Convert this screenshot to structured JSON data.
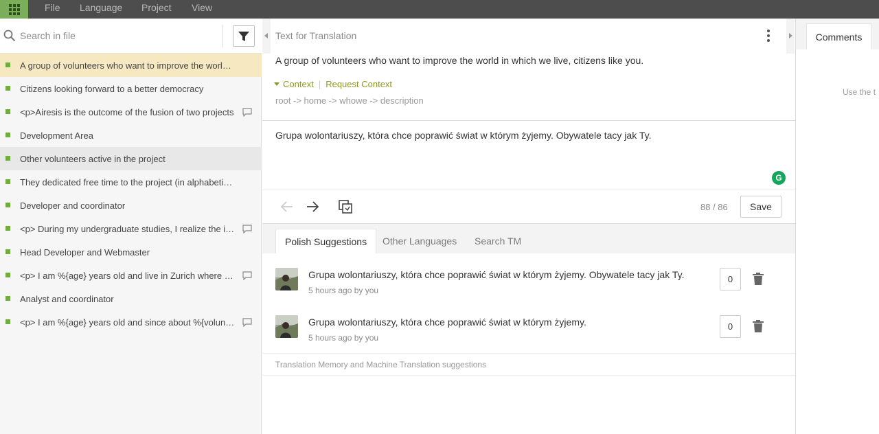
{
  "menubar": {
    "apps_icon": "grid-icon",
    "items": [
      {
        "label": "File"
      },
      {
        "label": "Language"
      },
      {
        "label": "Project"
      },
      {
        "label": "View"
      }
    ]
  },
  "search": {
    "placeholder": "Search in file",
    "icon": "search-icon",
    "filter_icon": "filter-icon"
  },
  "units": [
    {
      "text": "A group of volunteers who want to improve the world in which we live, citizens like you.",
      "state": "active",
      "has_comment": false
    },
    {
      "text": "Citizens looking forward to a better democracy",
      "state": "normal",
      "has_comment": false
    },
    {
      "text": "<p>Airesis is the outcome of the fusion of two projects",
      "state": "normal",
      "has_comment": true
    },
    {
      "text": "Development Area",
      "state": "normal",
      "has_comment": false
    },
    {
      "text": "Other volunteers active in the project",
      "state": "hover",
      "has_comment": false
    },
    {
      "text": "They dedicated free time to the project (in alphabetical order)",
      "state": "normal",
      "has_comment": false
    },
    {
      "text": "Developer and coordinator",
      "state": "normal",
      "has_comment": false
    },
    {
      "text": "<p> During my undergraduate studies, I realize the importance",
      "state": "normal",
      "has_comment": true
    },
    {
      "text": "Head Developer and Webmaster",
      "state": "normal",
      "has_comment": false
    },
    {
      "text": "<p> I am %{age} years old and live in Zurich where I work",
      "state": "normal",
      "has_comment": true
    },
    {
      "text": "Analyst and coordinator",
      "state": "normal",
      "has_comment": false
    },
    {
      "text": "<p> I am %{age} years old and since about %{volunteer} years",
      "state": "normal",
      "has_comment": true
    }
  ],
  "editor": {
    "source_label": "Text for Translation",
    "source_text": "A group of volunteers who want to improve the world in which we live, citizens like you.",
    "context_label": "Context",
    "request_context_label": "Request Context",
    "context_path": "root -> home -> whowe -> description",
    "target_text": "Grupa wolontariuszy, która chce poprawić świat w którym żyjemy. Obywatele tacy jak Ty.",
    "grammarly_label": "G",
    "counter": "88 / 86",
    "save_label": "Save"
  },
  "suggestion_tabs": [
    {
      "label": "Polish Suggestions",
      "active": true
    },
    {
      "label": "Other Languages",
      "active": false
    },
    {
      "label": "Search TM",
      "active": false
    }
  ],
  "suggestions": [
    {
      "text": "Grupa wolontariuszy, która chce poprawić świat w którym żyjemy. Obywatele tacy jak Ty.",
      "meta": "5 hours ago by you",
      "votes": "0"
    },
    {
      "text": "Grupa wolontariuszy, która chce poprawić świat w którym żyjemy.",
      "meta": "5 hours ago by you",
      "votes": "0"
    }
  ],
  "tm_label": "Translation Memory and Machine Translation suggestions",
  "comments": {
    "tab_label": "Comments",
    "hint": "Use the t"
  },
  "colors": {
    "menubar": "#4d4d4d",
    "accent_green": "#7bae5a",
    "unit_dot": "#6fae3a",
    "active_row": "#f6e9c2",
    "context_link": "#8a9a1f",
    "grammarly": "#15a55c"
  }
}
